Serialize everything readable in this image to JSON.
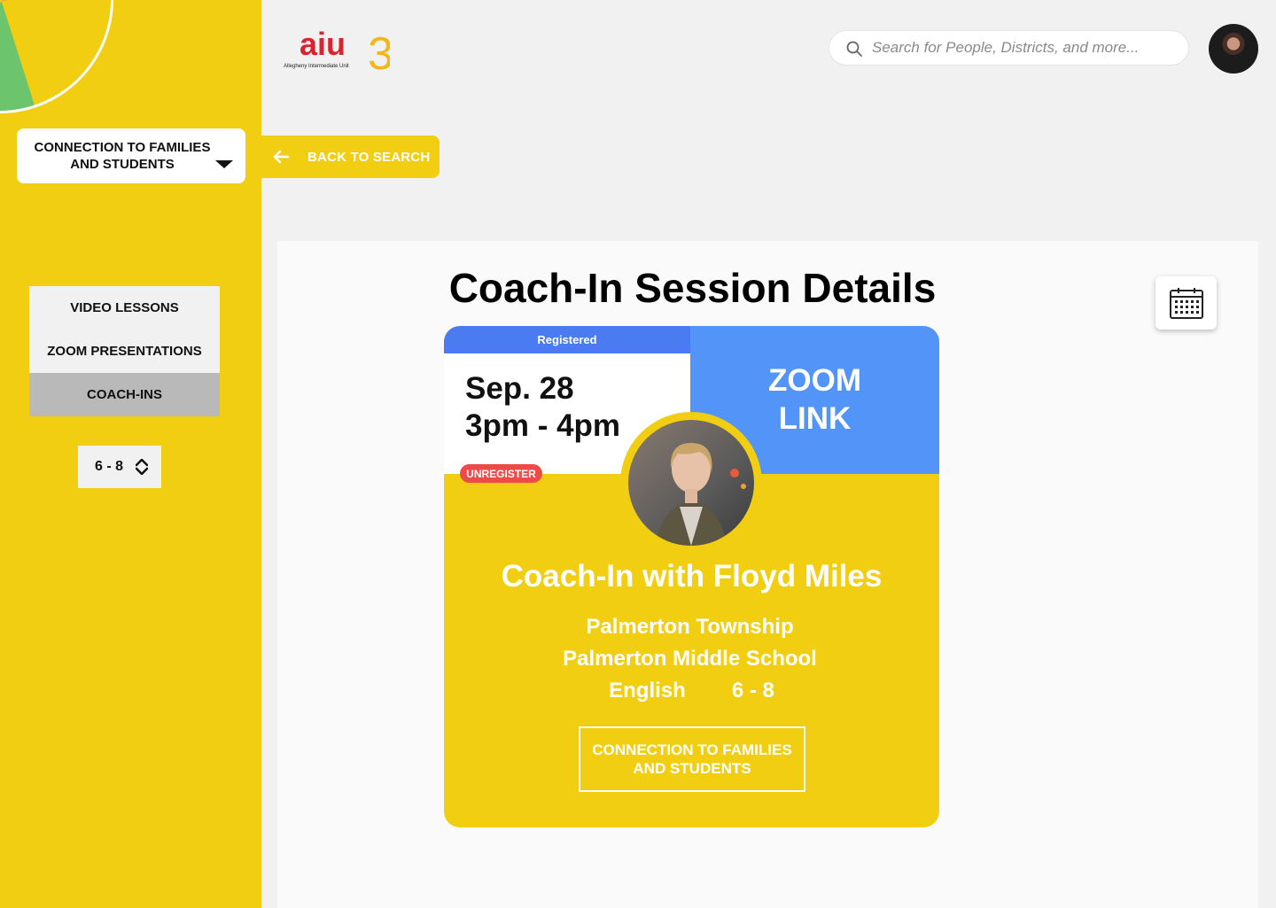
{
  "sidebar": {
    "category_dropdown": "CONNECTION TO FAMILIES AND STUDENTS",
    "nav_items": [
      {
        "label": "VIDEO LESSONS",
        "active": false
      },
      {
        "label": "ZOOM PRESENTATIONS",
        "active": false
      },
      {
        "label": "COACH-INS",
        "active": true
      }
    ],
    "grade_select": "6 - 8"
  },
  "header": {
    "logo_text": "aiu",
    "logo_number": "3",
    "logo_subtitle": "Allegheny Intermediate Unit",
    "search_placeholder": "Search for People, Districts, and more...",
    "back_button": "BACK TO SEARCH"
  },
  "main": {
    "title": "Coach-In Session Details",
    "card": {
      "status": "Registered",
      "date": "Sep. 28",
      "time": "3pm - 4pm",
      "unregister_label": "UNREGISTER",
      "zoom_link_label": "ZOOM LINK",
      "session_title": "Coach-In with Floyd Miles",
      "district": "Palmerton Township",
      "school": "Palmerton Middle School",
      "subject": "English",
      "grades": "6 - 8",
      "topic_button": "CONNECTION TO FAMILIES AND STUDENTS"
    }
  },
  "colors": {
    "brand_yellow": "#f2ce13",
    "registered_blue": "#4a7bf0",
    "zoom_blue": "#5294f7",
    "unregister_red": "#ef4a4a",
    "logo_red": "#d9232e",
    "logo_blue": "#1d64b5"
  },
  "icons": [
    "search-icon",
    "arrow-left-icon",
    "calendar-icon",
    "caret-down-icon",
    "sort-arrows-icon"
  ]
}
